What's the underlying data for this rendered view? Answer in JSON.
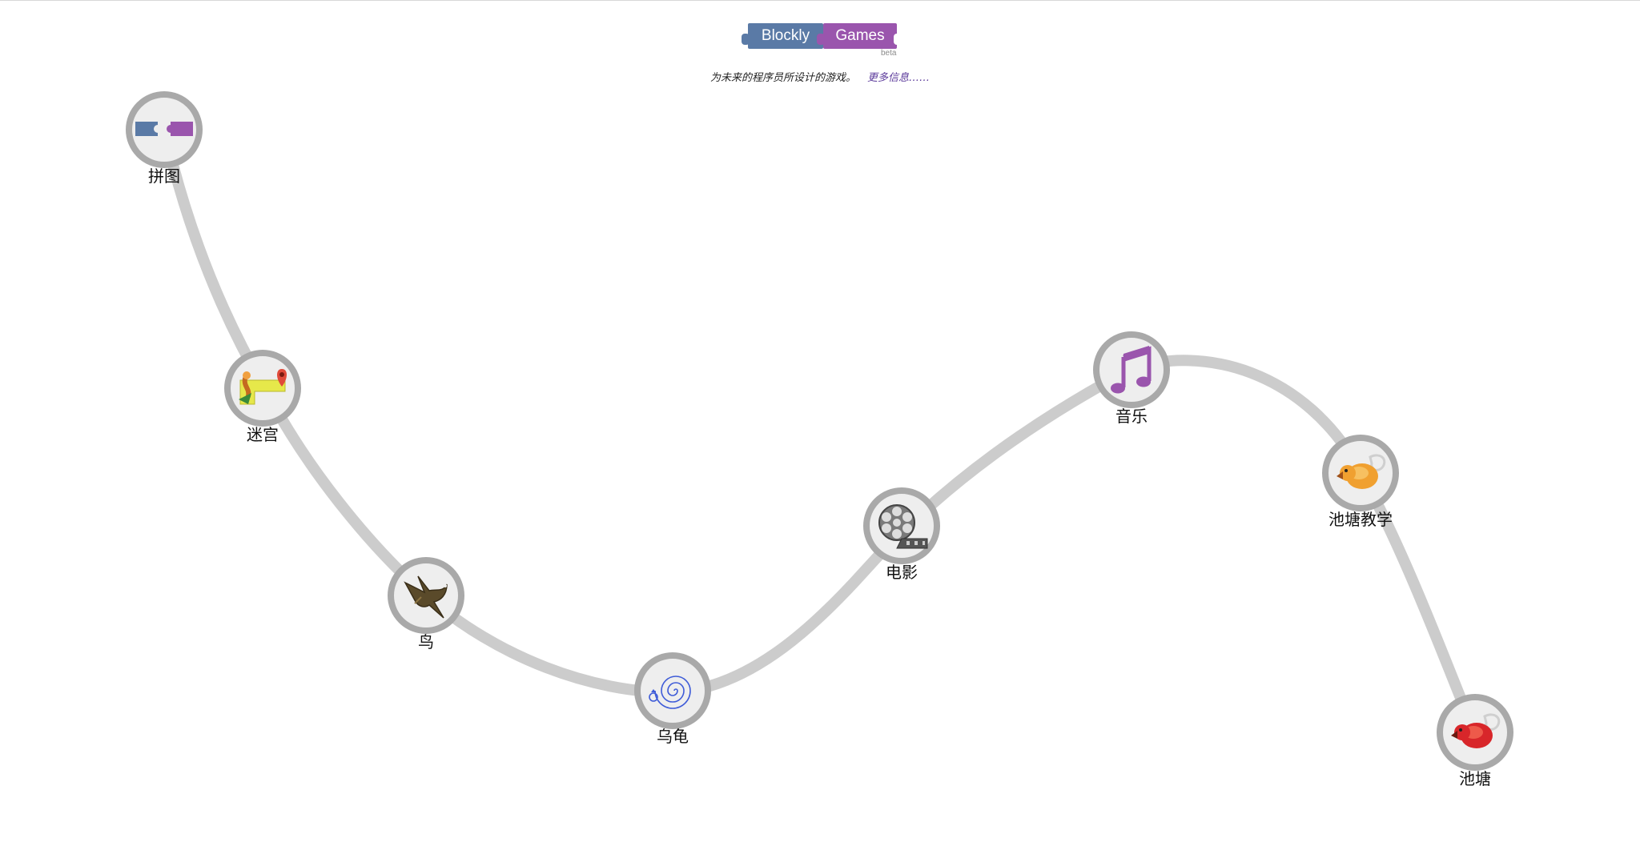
{
  "header": {
    "logo_left": "Blockly",
    "logo_right": "Games",
    "beta": "beta",
    "tagline": "为未来的程序员所设计的游戏。",
    "more_link": "更多信息……"
  },
  "colors": {
    "path": "#cccccc",
    "node_ring": "#a9a9a9",
    "node_fill": "#eeeeee",
    "blockly_blue": "#5a7aa6",
    "games_purple": "#9a55ad"
  },
  "games": [
    {
      "id": "puzzle",
      "label": "拼图",
      "icon": "puzzle-icon"
    },
    {
      "id": "maze",
      "label": "迷宫",
      "icon": "maze-icon"
    },
    {
      "id": "bird",
      "label": "鸟",
      "icon": "bird-icon"
    },
    {
      "id": "turtle",
      "label": "乌龟",
      "icon": "turtle-spiral-icon"
    },
    {
      "id": "movie",
      "label": "电影",
      "icon": "film-reel-icon"
    },
    {
      "id": "music",
      "label": "音乐",
      "icon": "music-note-icon"
    },
    {
      "id": "pond-tutor",
      "label": "池塘教学",
      "icon": "duck-orange-icon"
    },
    {
      "id": "pond",
      "label": "池塘",
      "icon": "duck-red-icon"
    }
  ]
}
